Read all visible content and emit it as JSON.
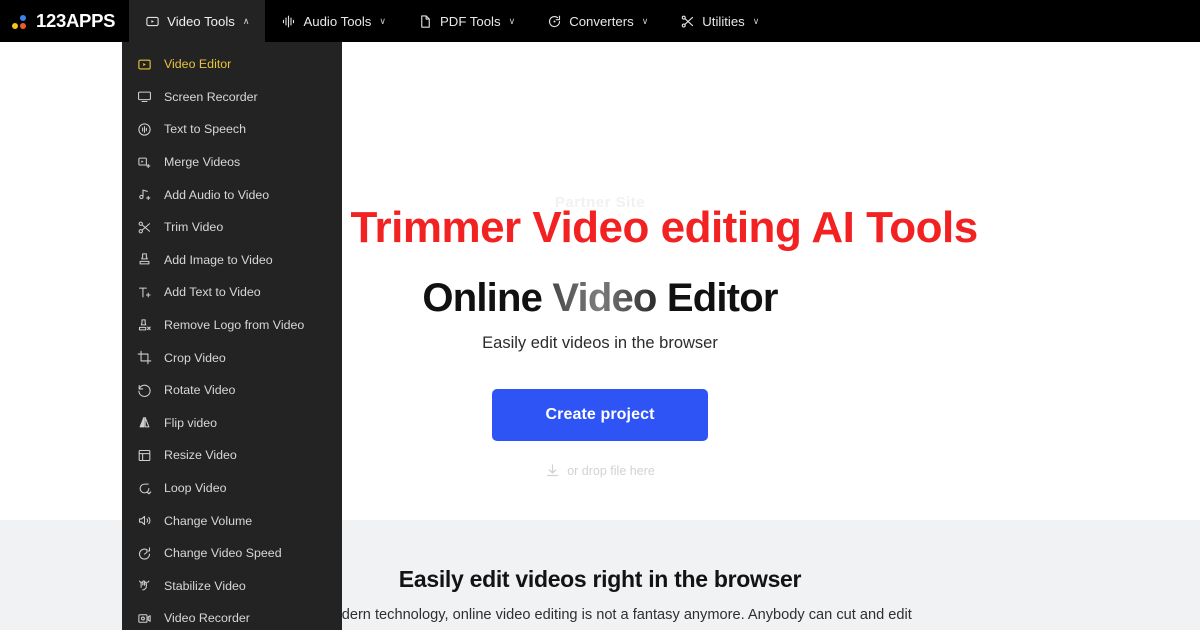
{
  "brand": {
    "name": "123APPS",
    "dot_blue": "#3b82f6",
    "dot_yellow": "#f5c518",
    "dot_red": "#f05a28"
  },
  "topnav": {
    "items": [
      {
        "label": "Video Tools",
        "icon": "video-play-box-icon",
        "caret": "∧",
        "active": true
      },
      {
        "label": "Audio Tools",
        "icon": "audio-waveform-icon",
        "caret": "∨",
        "active": false
      },
      {
        "label": "PDF Tools",
        "icon": "pdf-page-icon",
        "caret": "∨",
        "active": false
      },
      {
        "label": "Converters",
        "icon": "converter-refresh-icon",
        "caret": "∨",
        "active": false
      },
      {
        "label": "Utilities",
        "icon": "utilities-scissors-icon",
        "caret": "∨",
        "active": false
      }
    ]
  },
  "dropdown": {
    "items": [
      {
        "label": "Video Editor",
        "icon": "video-editor-icon",
        "highlight": true
      },
      {
        "label": "Screen Recorder",
        "icon": "monitor-icon",
        "highlight": false
      },
      {
        "label": "Text to Speech",
        "icon": "speech-circle-icon",
        "highlight": false
      },
      {
        "label": "Merge Videos",
        "icon": "merge-videos-icon",
        "highlight": false
      },
      {
        "label": "Add Audio to Video",
        "icon": "music-note-plus-icon",
        "highlight": false
      },
      {
        "label": "Trim Video",
        "icon": "scissors-icon",
        "highlight": false
      },
      {
        "label": "Add Image to Video",
        "icon": "image-stamp-icon",
        "highlight": false
      },
      {
        "label": "Add Text to Video",
        "icon": "text-plus-icon",
        "highlight": false
      },
      {
        "label": "Remove Logo from Video",
        "icon": "stamp-remove-icon",
        "highlight": false
      },
      {
        "label": "Crop Video",
        "icon": "crop-icon",
        "highlight": false
      },
      {
        "label": "Rotate Video",
        "icon": "rotate-ccw-icon",
        "highlight": false
      },
      {
        "label": "Flip video",
        "icon": "flip-icon",
        "highlight": false
      },
      {
        "label": "Resize Video",
        "icon": "resize-frame-icon",
        "highlight": false
      },
      {
        "label": "Loop Video",
        "icon": "loop-icon",
        "highlight": false
      },
      {
        "label": "Change Volume",
        "icon": "speaker-volume-icon",
        "highlight": false
      },
      {
        "label": "Change Video Speed",
        "icon": "speedometer-icon",
        "highlight": false
      },
      {
        "label": "Stabilize Video",
        "icon": "stabilize-hand-icon",
        "highlight": false
      },
      {
        "label": "Video Recorder",
        "icon": "camera-record-icon",
        "highlight": false
      }
    ]
  },
  "hero": {
    "ghost_text": "Partner Site",
    "overlay_title": "Video Trimmer Video editing AI Tools",
    "overlay_title_color": "#f32222",
    "title_part1": "Online ",
    "title_part2": "Video",
    "title_part3": " Editor",
    "subtitle": "Easily edit videos in the browser",
    "cta_label": "Create project",
    "cta_color": "#2f54f5",
    "drop_hint": "or drop file here",
    "drop_hint_icon": "download-tray-icon"
  },
  "lower": {
    "heading": "Easily edit videos right in the browser",
    "paragraph": "With modern technology, online video editing is not a fantasy anymore. Anybody can cut and edit",
    "background": "#f0f2f4"
  }
}
